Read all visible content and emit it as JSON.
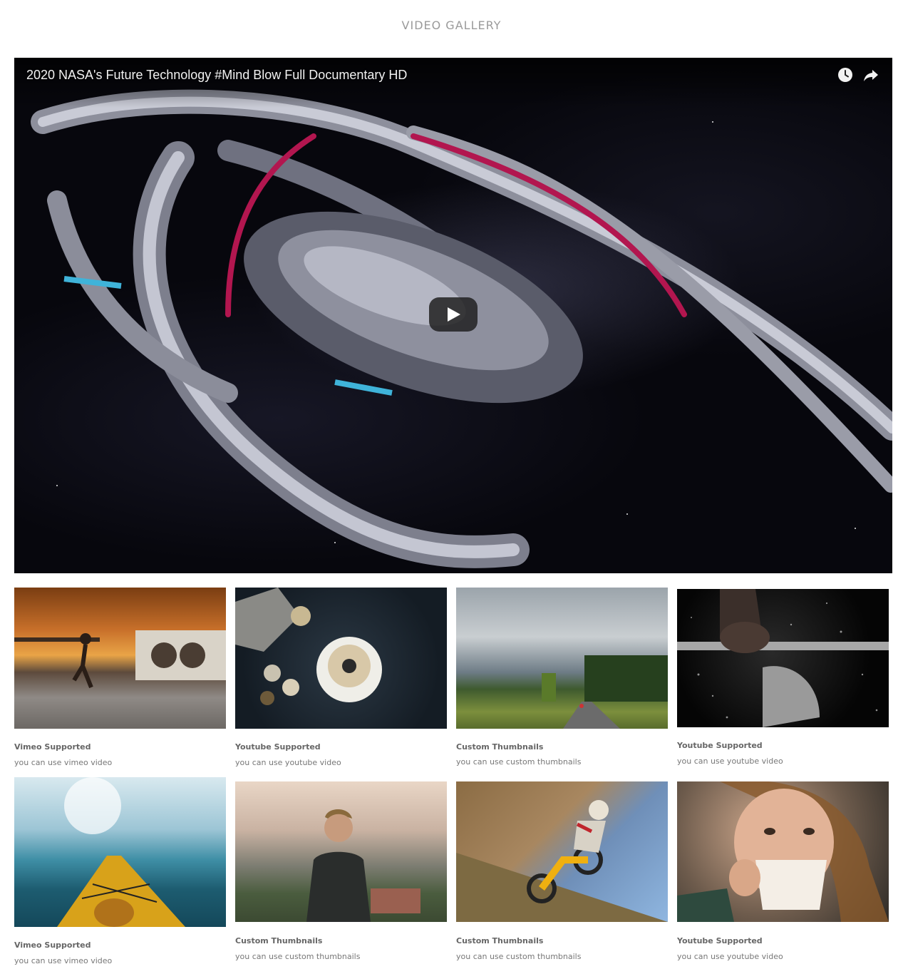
{
  "gallery": {
    "title": "VIDEO GALLERY"
  },
  "player": {
    "title": "2020 NASA's Future Technology #Mind Blow Full Documentary HD",
    "icons": [
      "clock-icon",
      "share-icon",
      "play-icon"
    ]
  },
  "videos": [
    {
      "label": "Vimeo Supported",
      "caption": "you can use vimeo video"
    },
    {
      "label": "Youtube Supported",
      "caption": "you can use youtube video"
    },
    {
      "label": "Custom Thumbnails",
      "caption": "you can use custom thumbnails"
    },
    {
      "label": "Youtube Supported",
      "caption": "you can use youtube video"
    },
    {
      "label": "Vimeo Supported",
      "caption": "you can use vimeo video"
    },
    {
      "label": "Custom Thumbnails",
      "caption": "you can use custom thumbnails"
    },
    {
      "label": "Custom Thumbnails",
      "caption": "you can use custom thumbnails"
    },
    {
      "label": "Youtube Supported",
      "caption": "you can use youtube video"
    }
  ]
}
